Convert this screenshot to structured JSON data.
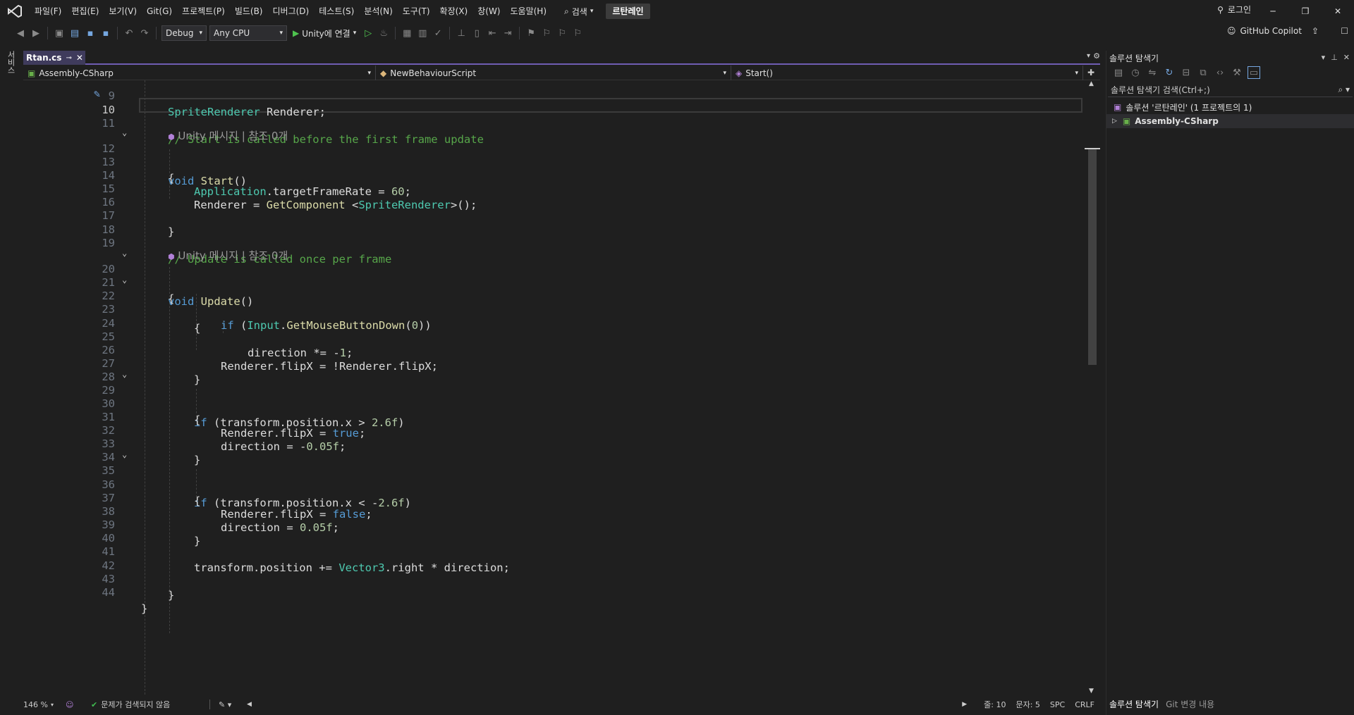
{
  "menu": {
    "items": [
      "파일(F)",
      "편집(E)",
      "보기(V)",
      "Git(G)",
      "프로젝트(P)",
      "빌드(B)",
      "디버그(D)",
      "테스트(S)",
      "분석(N)",
      "도구(T)",
      "확장(X)",
      "창(W)",
      "도움말(H)"
    ],
    "search_label": "검색",
    "solution_name": "르탄레인",
    "login_label": "로그인"
  },
  "toolbar": {
    "config": "Debug",
    "platform": "Any CPU",
    "run_label": "Unity에 연결",
    "copilot_label": "GitHub Copilot"
  },
  "left_strip_label": "서비스",
  "editor": {
    "tab_name": "Rtan.cs",
    "tab_pin": "⊸",
    "nav_project": "Assembly-CSharp",
    "nav_class": "NewBehaviourScript",
    "nav_member": "Start()",
    "zoom": "146 %",
    "issues": "문제가 검색되지 않음",
    "line_status": "줄: 10",
    "col_status": "문자: 5",
    "whitespace": "SPC",
    "line_ending": "CRLF",
    "lines": [
      {
        "num": "9",
        "text": "SpriteRenderer Renderer;",
        "active": false
      },
      {
        "num": "10",
        "text": "",
        "active": true
      },
      {
        "num": "11",
        "text": "// Start is called before the first frame update",
        "active": false
      },
      {
        "num": "12",
        "text": "void Start()",
        "active": false
      },
      {
        "num": "13",
        "text": "{",
        "active": false
      },
      {
        "num": "14",
        "text": "Application.targetFrameRate = 60;",
        "active": false
      },
      {
        "num": "15",
        "text": "Renderer = GetComponent <SpriteRenderer>();",
        "active": false
      },
      {
        "num": "16",
        "text": "",
        "active": false
      },
      {
        "num": "17",
        "text": "}",
        "active": false
      },
      {
        "num": "18",
        "text": "",
        "active": false
      },
      {
        "num": "19",
        "text": "// Update is called once per frame",
        "active": false
      },
      {
        "num": "20",
        "text": "void Update()",
        "active": false
      },
      {
        "num": "21",
        "text": "{",
        "active": false
      },
      {
        "num": "22",
        "text": "{",
        "active": false
      },
      {
        "num": "23",
        "text": "if (Input.GetMouseButtonDown(0))",
        "active": false
      },
      {
        "num": "24",
        "text": "",
        "active": false
      },
      {
        "num": "25",
        "text": "direction *= -1;",
        "active": false
      },
      {
        "num": "26",
        "text": "Renderer.flipX = !Renderer.flipX;",
        "active": false
      },
      {
        "num": "27",
        "text": "}",
        "active": false
      },
      {
        "num": "28",
        "text": "",
        "active": false
      },
      {
        "num": "29",
        "text": "if (transform.position.x > 2.6f)",
        "active": false
      },
      {
        "num": "30",
        "text": "{",
        "active": false
      },
      {
        "num": "31",
        "text": "Renderer.flipX = true;",
        "active": false
      },
      {
        "num": "32",
        "text": "direction = -0.05f;",
        "active": false
      },
      {
        "num": "33",
        "text": "}",
        "active": false
      },
      {
        "num": "34",
        "text": "",
        "active": false
      },
      {
        "num": "35",
        "text": "if (transform.position.x < -2.6f)",
        "active": false
      },
      {
        "num": "36",
        "text": "{",
        "active": false
      },
      {
        "num": "37",
        "text": "Renderer.flipX = false;",
        "active": false
      },
      {
        "num": "38",
        "text": "direction = 0.05f;",
        "active": false
      },
      {
        "num": "39",
        "text": "}",
        "active": false
      },
      {
        "num": "40",
        "text": "",
        "active": false
      },
      {
        "num": "41",
        "text": "transform.position += Vector3.right * direction;",
        "active": false
      },
      {
        "num": "42",
        "text": "",
        "active": false
      },
      {
        "num": "43",
        "text": "}",
        "active": false
      },
      {
        "num": "44",
        "text": "}",
        "active": false
      }
    ],
    "codelens": "Unity 메시지 | 참조 0개"
  },
  "solution_explorer": {
    "title": "솔루션 탐색기",
    "search_placeholder": "솔루션 탐색기 검색(Ctrl+;)",
    "solution_row": "솔루션 '르탄레인' (1 프로젝트의 1)",
    "project_row": "Assembly-CSharp",
    "bottom_tab_1": "솔루션 탐색기",
    "bottom_tab_2": "Git 변경 내용"
  },
  "colors": {
    "accent": "#6f5db3",
    "keyword": "#569cd6",
    "type": "#4ec9b0",
    "method": "#dcdcaa",
    "comment": "#57a64a",
    "number": "#b5cea8"
  }
}
